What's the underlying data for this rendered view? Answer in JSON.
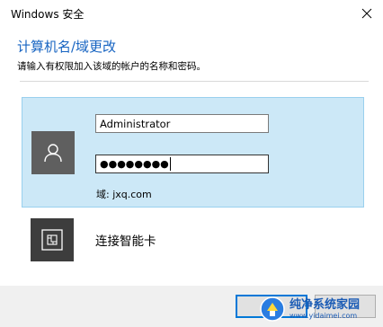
{
  "window": {
    "title": "Windows 安全"
  },
  "header": {
    "heading": "计算机名/域更改",
    "subtext": "请输入有权限加入该域的帐户的名称和密码。"
  },
  "credential": {
    "username_value": "Administrator",
    "password_mask": "●●●●●●●●",
    "domain_line": "域: jxq.com"
  },
  "smartcard": {
    "label": "连接智能卡"
  },
  "watermark": {
    "title": "纯净系统家园",
    "url": "www.yidaimei.com"
  },
  "colors": {
    "accent": "#1764c2",
    "selected_tile": "#cce8f7",
    "avatar_bg": "#5f5f5f",
    "smartcard_bg": "#3d3d3d",
    "footer_bg": "#f0f0f0",
    "focus_border": "#0078d7"
  }
}
